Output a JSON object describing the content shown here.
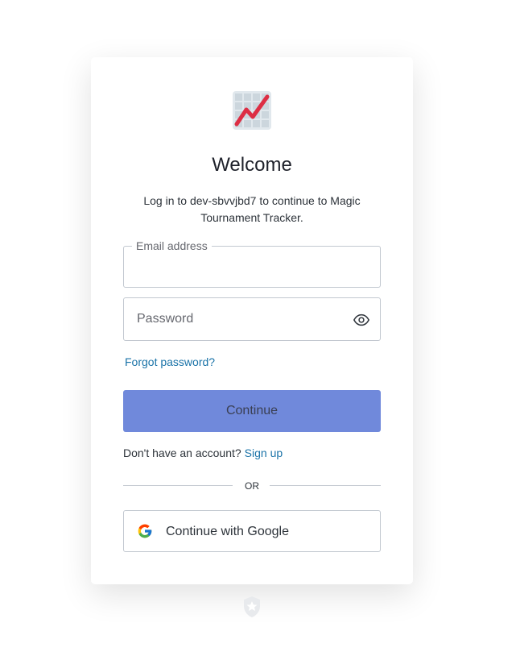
{
  "header": {
    "title": "Welcome",
    "subtitle": "Log in to dev-sbvvjbd7 to continue to Magic Tournament Tracker."
  },
  "form": {
    "email_label": "Email address",
    "email_value": "",
    "password_placeholder": "Password",
    "password_value": "",
    "forgot_password": "Forgot password?",
    "continue_label": "Continue"
  },
  "signup": {
    "prompt": "Don't have an account?",
    "link": "Sign up"
  },
  "divider": {
    "text": "OR"
  },
  "social": {
    "google_label": "Continue with Google"
  },
  "icons": {
    "logo": "chart-trend-icon",
    "password_toggle": "eye-icon",
    "google": "google-icon",
    "footer": "shield-star-icon"
  },
  "colors": {
    "primary_button": "#7089db",
    "link": "#1a73a8",
    "border": "#c2c8d0",
    "logo_line": "#dd2e44"
  }
}
